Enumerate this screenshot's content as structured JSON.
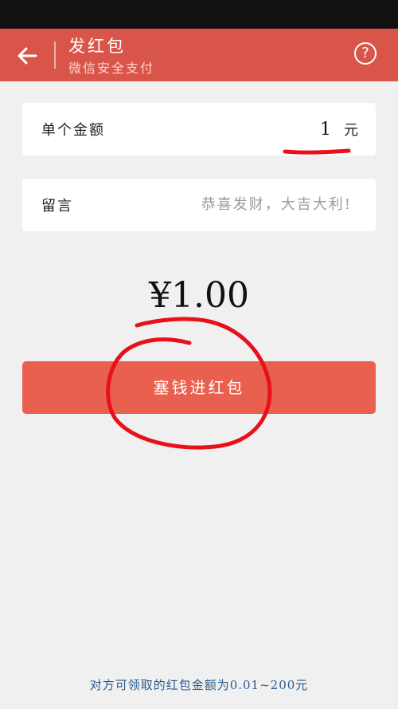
{
  "header": {
    "title": "发红包",
    "subtitle": "微信安全支付",
    "back_icon": "back-arrow-icon",
    "help_label": "?"
  },
  "amount_row": {
    "label": "单个金额",
    "value": "1",
    "unit": "元"
  },
  "message_row": {
    "label": "留言",
    "placeholder": "恭喜发财，大吉大利!"
  },
  "amount_display": "¥1.00",
  "send_button": {
    "label": "塞钱进红包"
  },
  "footer_note": "对方可领取的红包金额为0.01~200元",
  "colors": {
    "header_bg": "#d9554a",
    "button_bg": "#e9604f",
    "annotation": "#e8101a",
    "page_bg": "#f0f0f0"
  }
}
